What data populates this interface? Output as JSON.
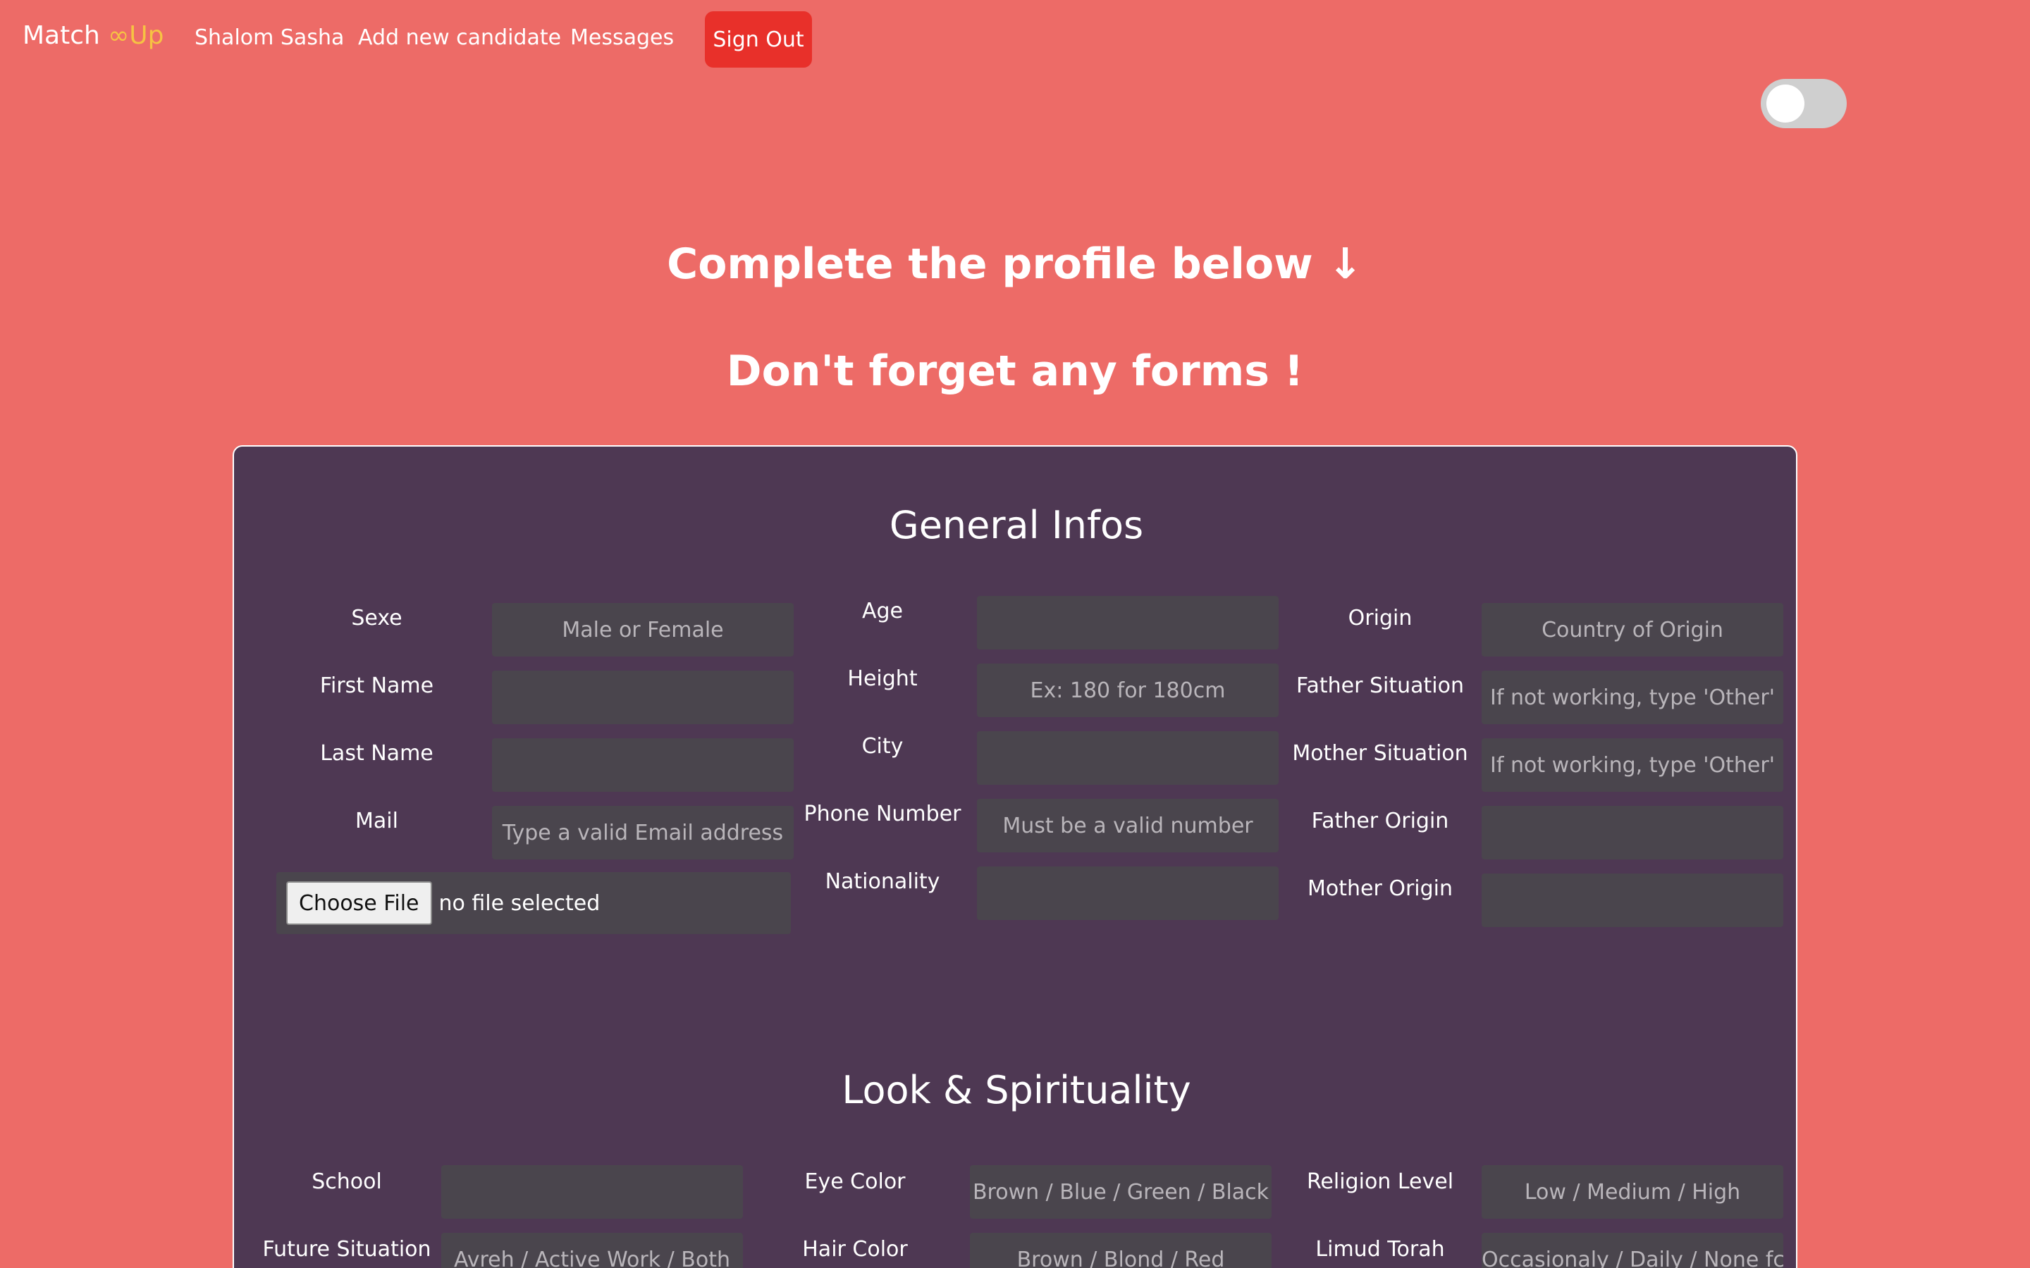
{
  "nav": {
    "brand_main": "Match ",
    "brand_accent": "∞Up",
    "greeting": "Shalom Sasha",
    "add_candidate": "Add new candidate",
    "messages": "Messages",
    "sign_out": "Sign Out"
  },
  "headings": {
    "line1": "Complete the profile below ↓",
    "line2": "Don't forget any forms !"
  },
  "general": {
    "title": "General Infos",
    "sexe": {
      "label": "Sexe",
      "placeholder": "Male or Female"
    },
    "first_name": {
      "label": "First Name",
      "placeholder": ""
    },
    "last_name": {
      "label": "Last Name",
      "placeholder": ""
    },
    "mail": {
      "label": "Mail",
      "placeholder": "Type a valid Email address"
    },
    "file": {
      "button": "Choose File",
      "status": "no file selected"
    },
    "age": {
      "label": "Age",
      "placeholder": ""
    },
    "height": {
      "label": "Height",
      "placeholder": "Ex: 180 for 180cm"
    },
    "city": {
      "label": "City",
      "placeholder": ""
    },
    "phone": {
      "label": "Phone Number",
      "placeholder": "Must be a valid number"
    },
    "nationality": {
      "label": "Nationality",
      "placeholder": ""
    },
    "origin": {
      "label": "Origin",
      "placeholder": "Country of Origin"
    },
    "father_situation": {
      "label": "Father Situation",
      "placeholder": "If not working, type 'Other'"
    },
    "mother_situation": {
      "label": "Mother Situation",
      "placeholder": "If not working, type 'Other'"
    },
    "father_origin": {
      "label": "Father Origin",
      "placeholder": ""
    },
    "mother_origin": {
      "label": "Mother Origin",
      "placeholder": ""
    }
  },
  "look": {
    "title": "Look & Spirituality",
    "school": {
      "label": "School",
      "placeholder": ""
    },
    "future_situation": {
      "label": "Future Situation",
      "placeholder": "Avreh / Active Work / Both"
    },
    "eye_color": {
      "label": "Eye Color",
      "placeholder": "Brown / Blue / Green / Black"
    },
    "hair_color": {
      "label": "Hair Color",
      "placeholder": "Brown / Blond / Red"
    },
    "religion_level": {
      "label": "Religion Level",
      "placeholder": "Low / Medium / High"
    },
    "limud_torah": {
      "label": "Limud Torah",
      "placeholder": "Occasionaly / Daily / None fc"
    }
  },
  "colors": {
    "background": "#ed6b67",
    "card": "#4e3853",
    "input": "#4a454d",
    "sign_out": "#e8302a",
    "brand_accent": "#f6c343"
  },
  "theme_toggle": {
    "on": false
  }
}
